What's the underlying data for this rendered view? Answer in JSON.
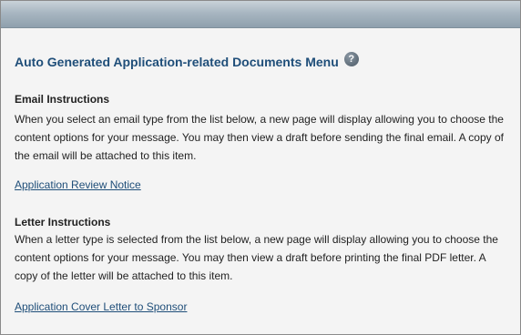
{
  "menu": {
    "title": "Auto Generated Application-related Documents Menu",
    "help_icon": "question-mark-icon",
    "help_glyph": "?"
  },
  "email": {
    "heading": "Email Instructions",
    "instructions": "When you select an email type from the list below, a new page will display allowing you to choose the content options for your message. You may then view a draft before sending the final email. A copy of the email will be attached to this item.",
    "link_label": "Application Review Notice"
  },
  "letter": {
    "heading": "Letter Instructions",
    "instructions": "When a letter type is selected from the list below, a new page will display allowing you to choose the content options for your message. You may then view a draft before printing the final PDF letter. A copy of the letter will be attached to this item.",
    "link_label": "Application Cover Letter to Sponsor"
  },
  "colors": {
    "title": "#1f4e79",
    "link": "#1f4e79",
    "background": "#f4f4f4",
    "header_bar": "#a8b6c1"
  }
}
